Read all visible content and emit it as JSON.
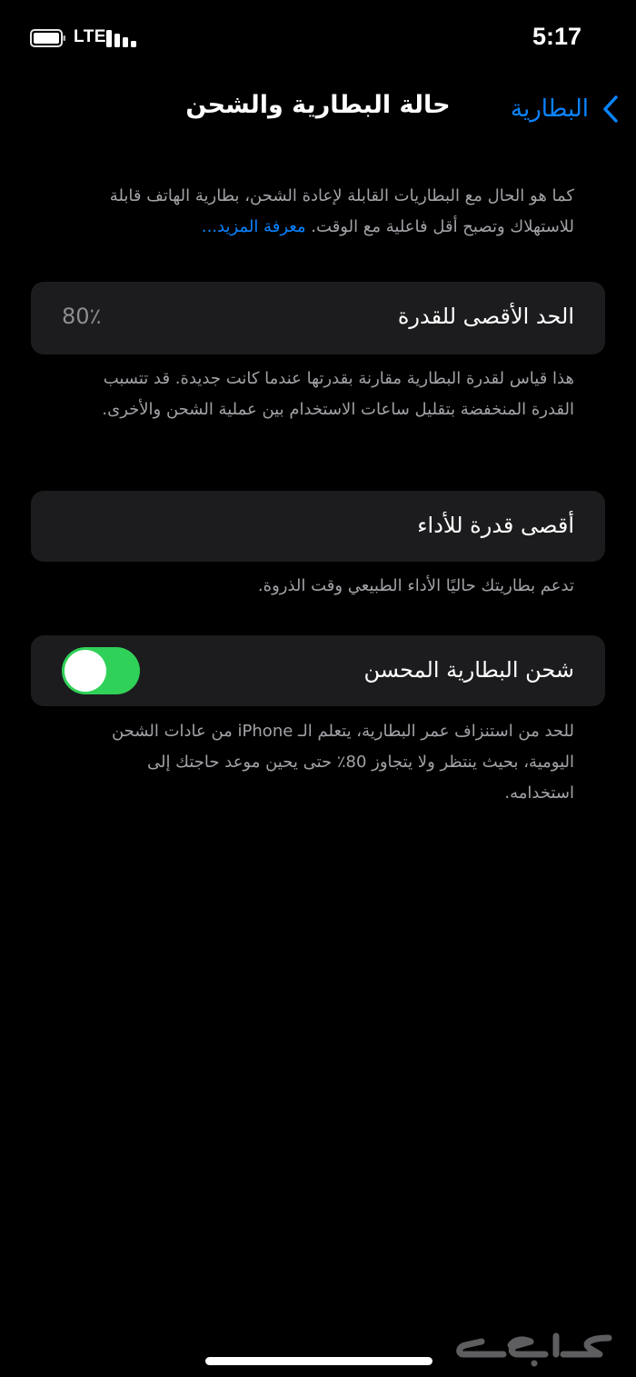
{
  "status_bar": {
    "network": "LTE",
    "time": "5:17"
  },
  "nav": {
    "title": "حالة البطارية والشحن",
    "back_label": "البطارية"
  },
  "intro": {
    "text": "كما هو الحال مع البطاريات القابلة لإعادة الشحن، بطارية الهاتف قابلة للاستهلاك وتصبح أقل فاعلية مع الوقت. ",
    "learn_more": "معرفة المزيد..."
  },
  "max_capacity": {
    "label": "الحد الأقصى للقدرة",
    "value": "80٪",
    "description": "هذا قياس لقدرة البطارية مقارنة بقدرتها عندما كانت جديدة. قد تتسبب القدرة المنخفضة بتقليل ساعات الاستخدام بين عملية الشحن والأخرى."
  },
  "peak_performance": {
    "label": "أقصى قدرة للأداء",
    "description": "تدعم بطاريتك حاليًا الأداء الطبيعي وقت الذروة."
  },
  "optimized_charging": {
    "label": "شحن البطارية المحسن",
    "enabled": true,
    "description": "للحد من استنزاف عمر البطارية، يتعلم الـ iPhone من عادات الشحن اليومية، بحيث ينتظر ولا يتجاوز 80٪ حتى يحين موعد حاجتك إلى استخدامه."
  },
  "watermark": {
    "text": "حراج"
  },
  "colors": {
    "accent": "#0a84ff",
    "toggle_on": "#30d158",
    "card_bg": "#1c1c1e",
    "secondary_text": "#a2a2a7"
  }
}
